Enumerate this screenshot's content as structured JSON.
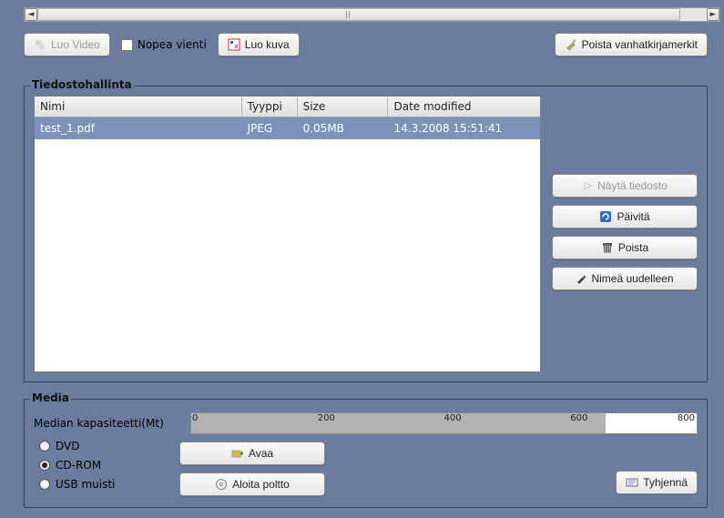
{
  "toolbar": {
    "create_video": "Luo Video",
    "fast_export": "Nopea vienti",
    "create_image": "Luo kuva",
    "remove_old_bookmarks": "Poista vanhatkirjamerkit"
  },
  "file_manager": {
    "title": "Tiedostohallinta",
    "columns": {
      "name": "Nimi",
      "type": "Tyyppi",
      "size": "Size",
      "date": "Date modified"
    },
    "rows": [
      {
        "name": "test_1.pdf",
        "type": "JPEG",
        "size": "0.05MB",
        "date": "14.3.2008 15:51:41"
      }
    ],
    "buttons": {
      "show_file": "Näytä tiedosto",
      "refresh": "Päivitä",
      "delete": "Poista",
      "rename": "Nimeä uudelleen"
    }
  },
  "media": {
    "title": "Media",
    "capacity_label": "Median kapasiteetti(Mt)",
    "ticks": [
      "0",
      "200",
      "400",
      "600",
      "800"
    ],
    "radios": {
      "dvd": "DVD",
      "cdrom": "CD-ROM",
      "usb": "USB muisti"
    },
    "selected_radio": "cdrom",
    "open": "Avaa",
    "burn": "Aloita poltto",
    "clear": "Tyhjennä"
  }
}
